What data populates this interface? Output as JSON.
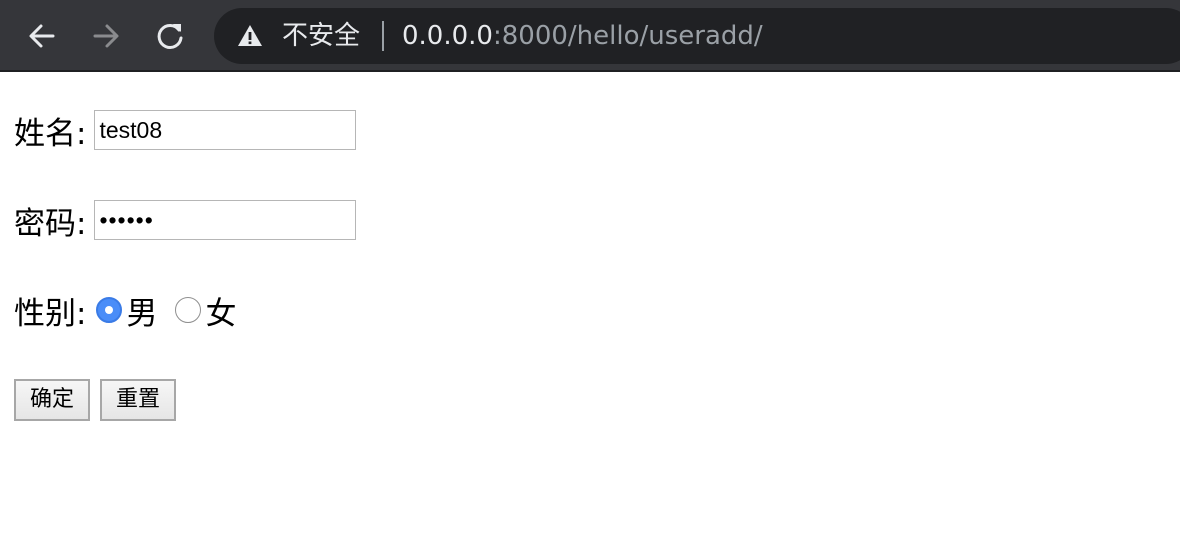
{
  "browser": {
    "security_label": "不安全",
    "url_host": "0.0.0.0",
    "url_rest": ":8000/hello/useradd/",
    "icons": {
      "back": "arrow-left-icon",
      "forward": "arrow-right-icon",
      "reload": "reload-icon",
      "warning": "warning-triangle-icon"
    },
    "colors": {
      "toolbar": "#35363a",
      "omnibox": "#202124",
      "text": "#e8eaed",
      "muted": "#9aa0a6"
    }
  },
  "form": {
    "name_label": "姓名:",
    "name_value": "test08",
    "password_label": "密码:",
    "password_masked": "••••••",
    "gender_label": "性别:",
    "gender_options": [
      {
        "label": "男",
        "checked": true
      },
      {
        "label": "女",
        "checked": false
      }
    ],
    "submit_label": "确定",
    "reset_label": "重置",
    "radio_accent": "#4a8df8"
  }
}
